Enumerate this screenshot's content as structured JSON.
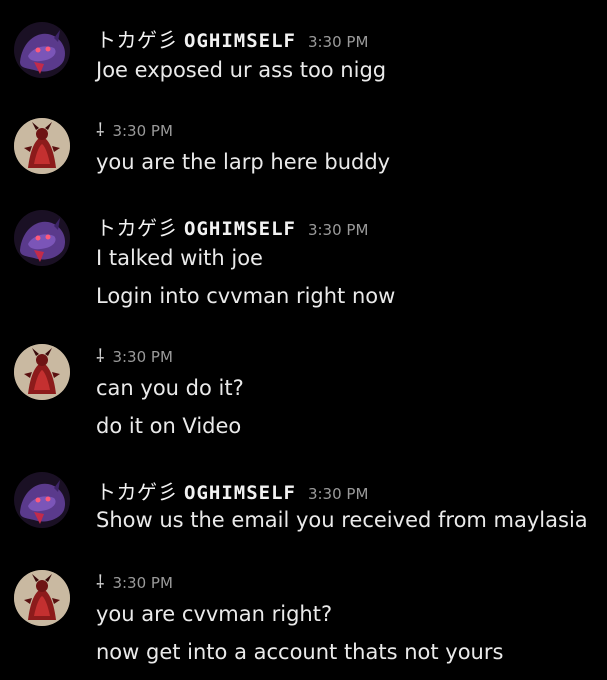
{
  "chat": {
    "messages": [
      {
        "author_prefix": "トカゲ彡",
        "author_name": "OGHIMSELF",
        "avatar": "purple-creature-avatar",
        "time": "3:30 PM",
        "lines": [
          "Joe exposed ur ass too nigg"
        ]
      },
      {
        "author_name": "⸸",
        "avatar": "red-demon-avatar",
        "time": "3:30 PM",
        "lines": [
          "you are the larp here buddy"
        ]
      },
      {
        "author_prefix": "トカゲ彡",
        "author_name": "OGHIMSELF",
        "avatar": "purple-creature-avatar",
        "time": "3:30 PM",
        "lines": [
          "I talked with joe",
          "Login into cvvman right now"
        ]
      },
      {
        "author_name": "⸸",
        "avatar": "red-demon-avatar",
        "time": "3:30 PM",
        "lines": [
          "can you do it?",
          "do it on Video"
        ]
      },
      {
        "author_prefix": "トカゲ彡",
        "author_name": "OGHIMSELF",
        "avatar": "purple-creature-avatar",
        "time": "3:30 PM",
        "lines": [
          "Show us the email you received from maylasia"
        ]
      },
      {
        "author_name": "⸸",
        "avatar": "red-demon-avatar",
        "time": "3:30 PM",
        "lines": [
          "you are cvvman right?",
          "now get into a account thats not yours"
        ]
      }
    ]
  },
  "colors": {
    "background": "#000000",
    "text": "#eaeaea",
    "timestamp": "#9a9a9a"
  }
}
